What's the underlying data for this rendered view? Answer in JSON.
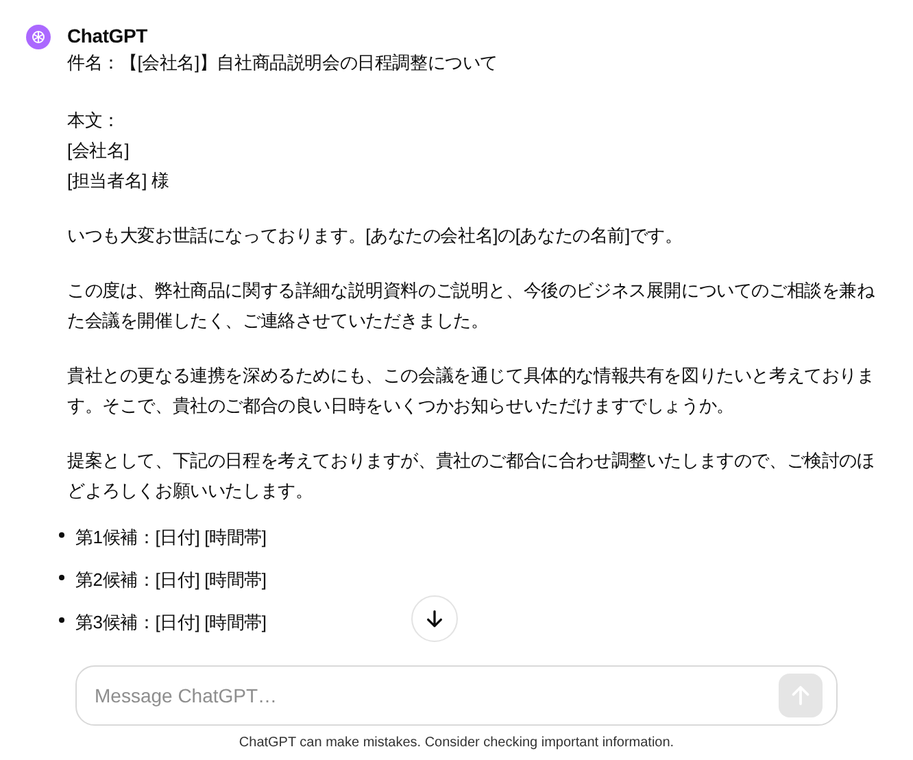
{
  "message": {
    "sender": "ChatGPT",
    "subject": "件名：【[会社名]】自社商品説明会の日程調整について",
    "header_lines": [
      "本文：",
      "[会社名]",
      "[担当者名] 様"
    ],
    "paragraphs": [
      "いつも大変お世話になっております。[あなたの会社名]の[あなたの名前]です。",
      "この度は、弊社商品に関する詳細な説明資料のご説明と、今後のビジネス展開についてのご相談を兼ねた会議を開催したく、ご連絡させていただきました。",
      "貴社との更なる連携を深めるためにも、この会議を通じて具体的な情報共有を図りたいと考えております。そこで、貴社のご都合の良い日時をいくつかお知らせいただけますでしょうか。",
      "提案として、下記の日程を考えておりますが、貴社のご都合に合わせ調整いたしますので、ご検討のほどよろしくお願いいたします。"
    ],
    "bullets": [
      "第1候補：[日付] [時間帯]",
      "第2候補：[日付] [時間帯]",
      "第3候補：[日付] [時間帯]"
    ]
  },
  "composer": {
    "placeholder": "Message ChatGPT…",
    "send_disabled": true
  },
  "footer": "ChatGPT can make mistakes. Consider checking important information."
}
